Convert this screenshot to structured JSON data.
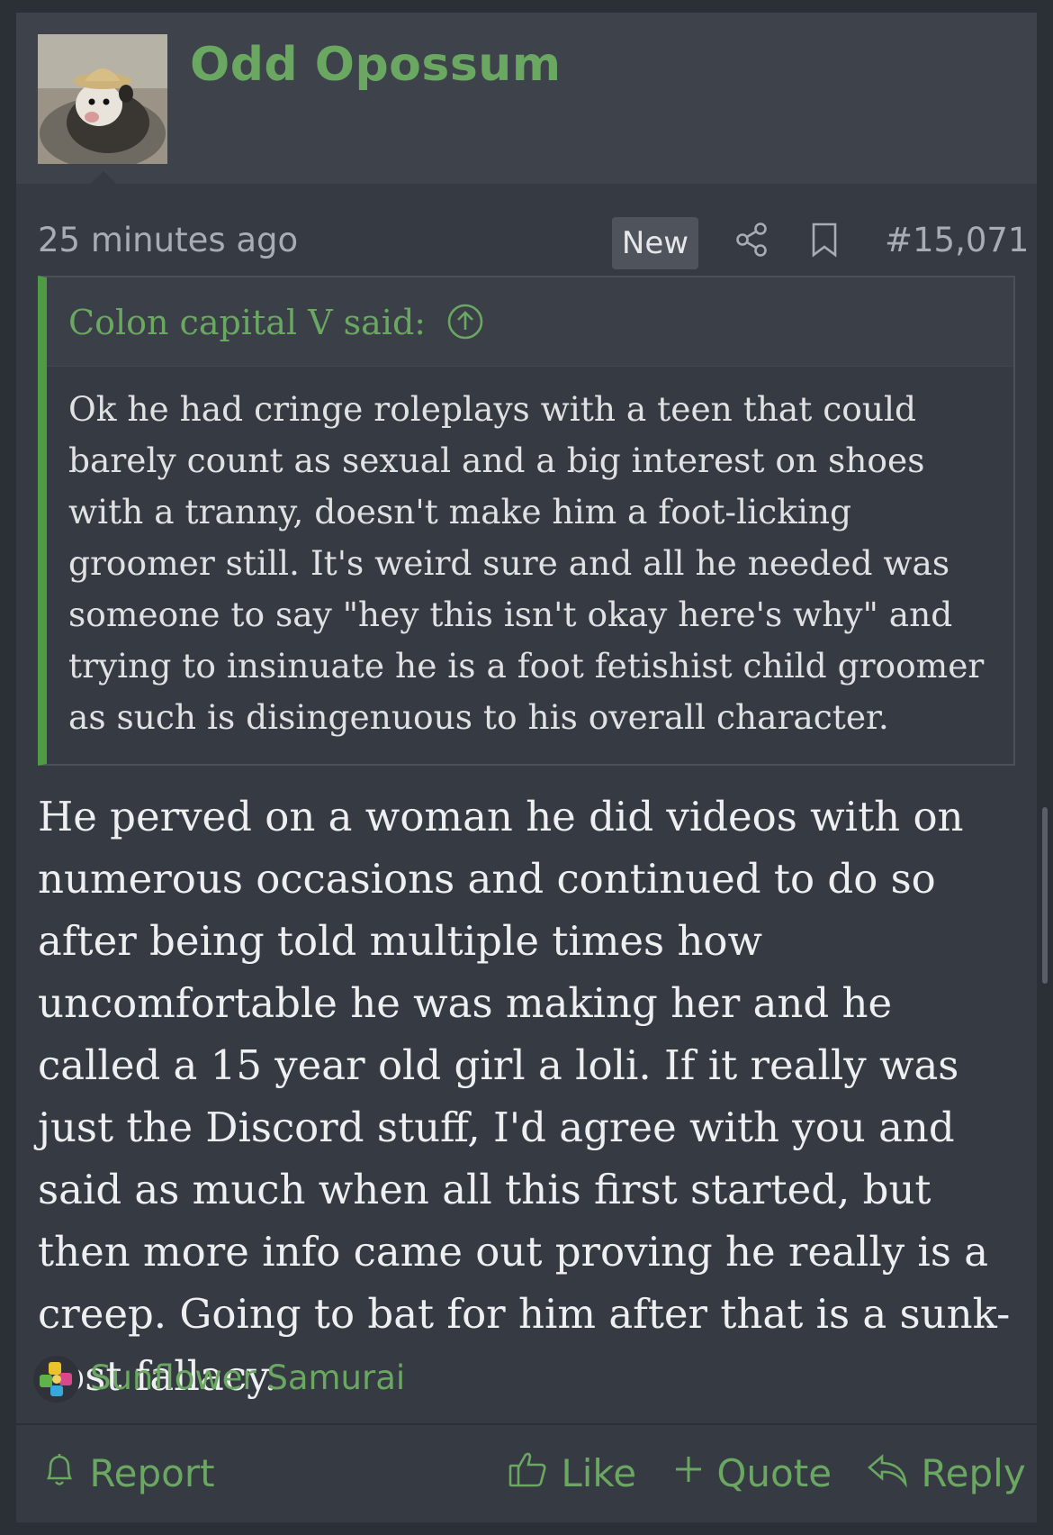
{
  "post": {
    "username": "Odd Opossum",
    "timestamp": "25 minutes ago",
    "badge": "New",
    "post_number": "#15,071",
    "quote": {
      "author": "Colon capital V said:",
      "text": "Ok he had cringe roleplays with a teen that could barely count as sexual and a big interest on shoes with a tranny, doesn't make him a foot-licking groomer still. It's weird sure and all he needed was someone to say \"hey this isn't okay here's why\" and trying to insinuate he is a foot fetishist child groomer as such is disingenuous to his overall character."
    },
    "body": "He perved on a woman he did videos with on numerous occasions and continued to do so after being told multiple times how uncomfortable he was making her and he called a 15 year old girl a loli. If it really was just the Discord stuff, I'd agree with you and said as much when all this first started, but then more info came out proving he really is a creep. Going to bat for him after that is a sunk-cost fallacy.",
    "reactions": {
      "user": "Sunflower Samurai"
    }
  },
  "actions": {
    "report": "Report",
    "like": "Like",
    "quote": "Quote",
    "reply": "Reply"
  },
  "icons": {
    "share": "share-icon",
    "bookmark": "bookmark-icon",
    "quote_up": "arrow-up-circle-icon",
    "report": "bell-icon",
    "like": "thumbs-up-icon",
    "quote": "plus-icon",
    "reply": "reply-arrow-icon",
    "reaction": "sunflower-puzzle-icon"
  },
  "colors": {
    "background": "#2b2f36",
    "post": "#363a42",
    "header": "#3d424b",
    "accent_green": "#6aa761",
    "quote_bar": "#4f9a45",
    "text": "#eeeff1",
    "muted": "#a8adb5"
  }
}
